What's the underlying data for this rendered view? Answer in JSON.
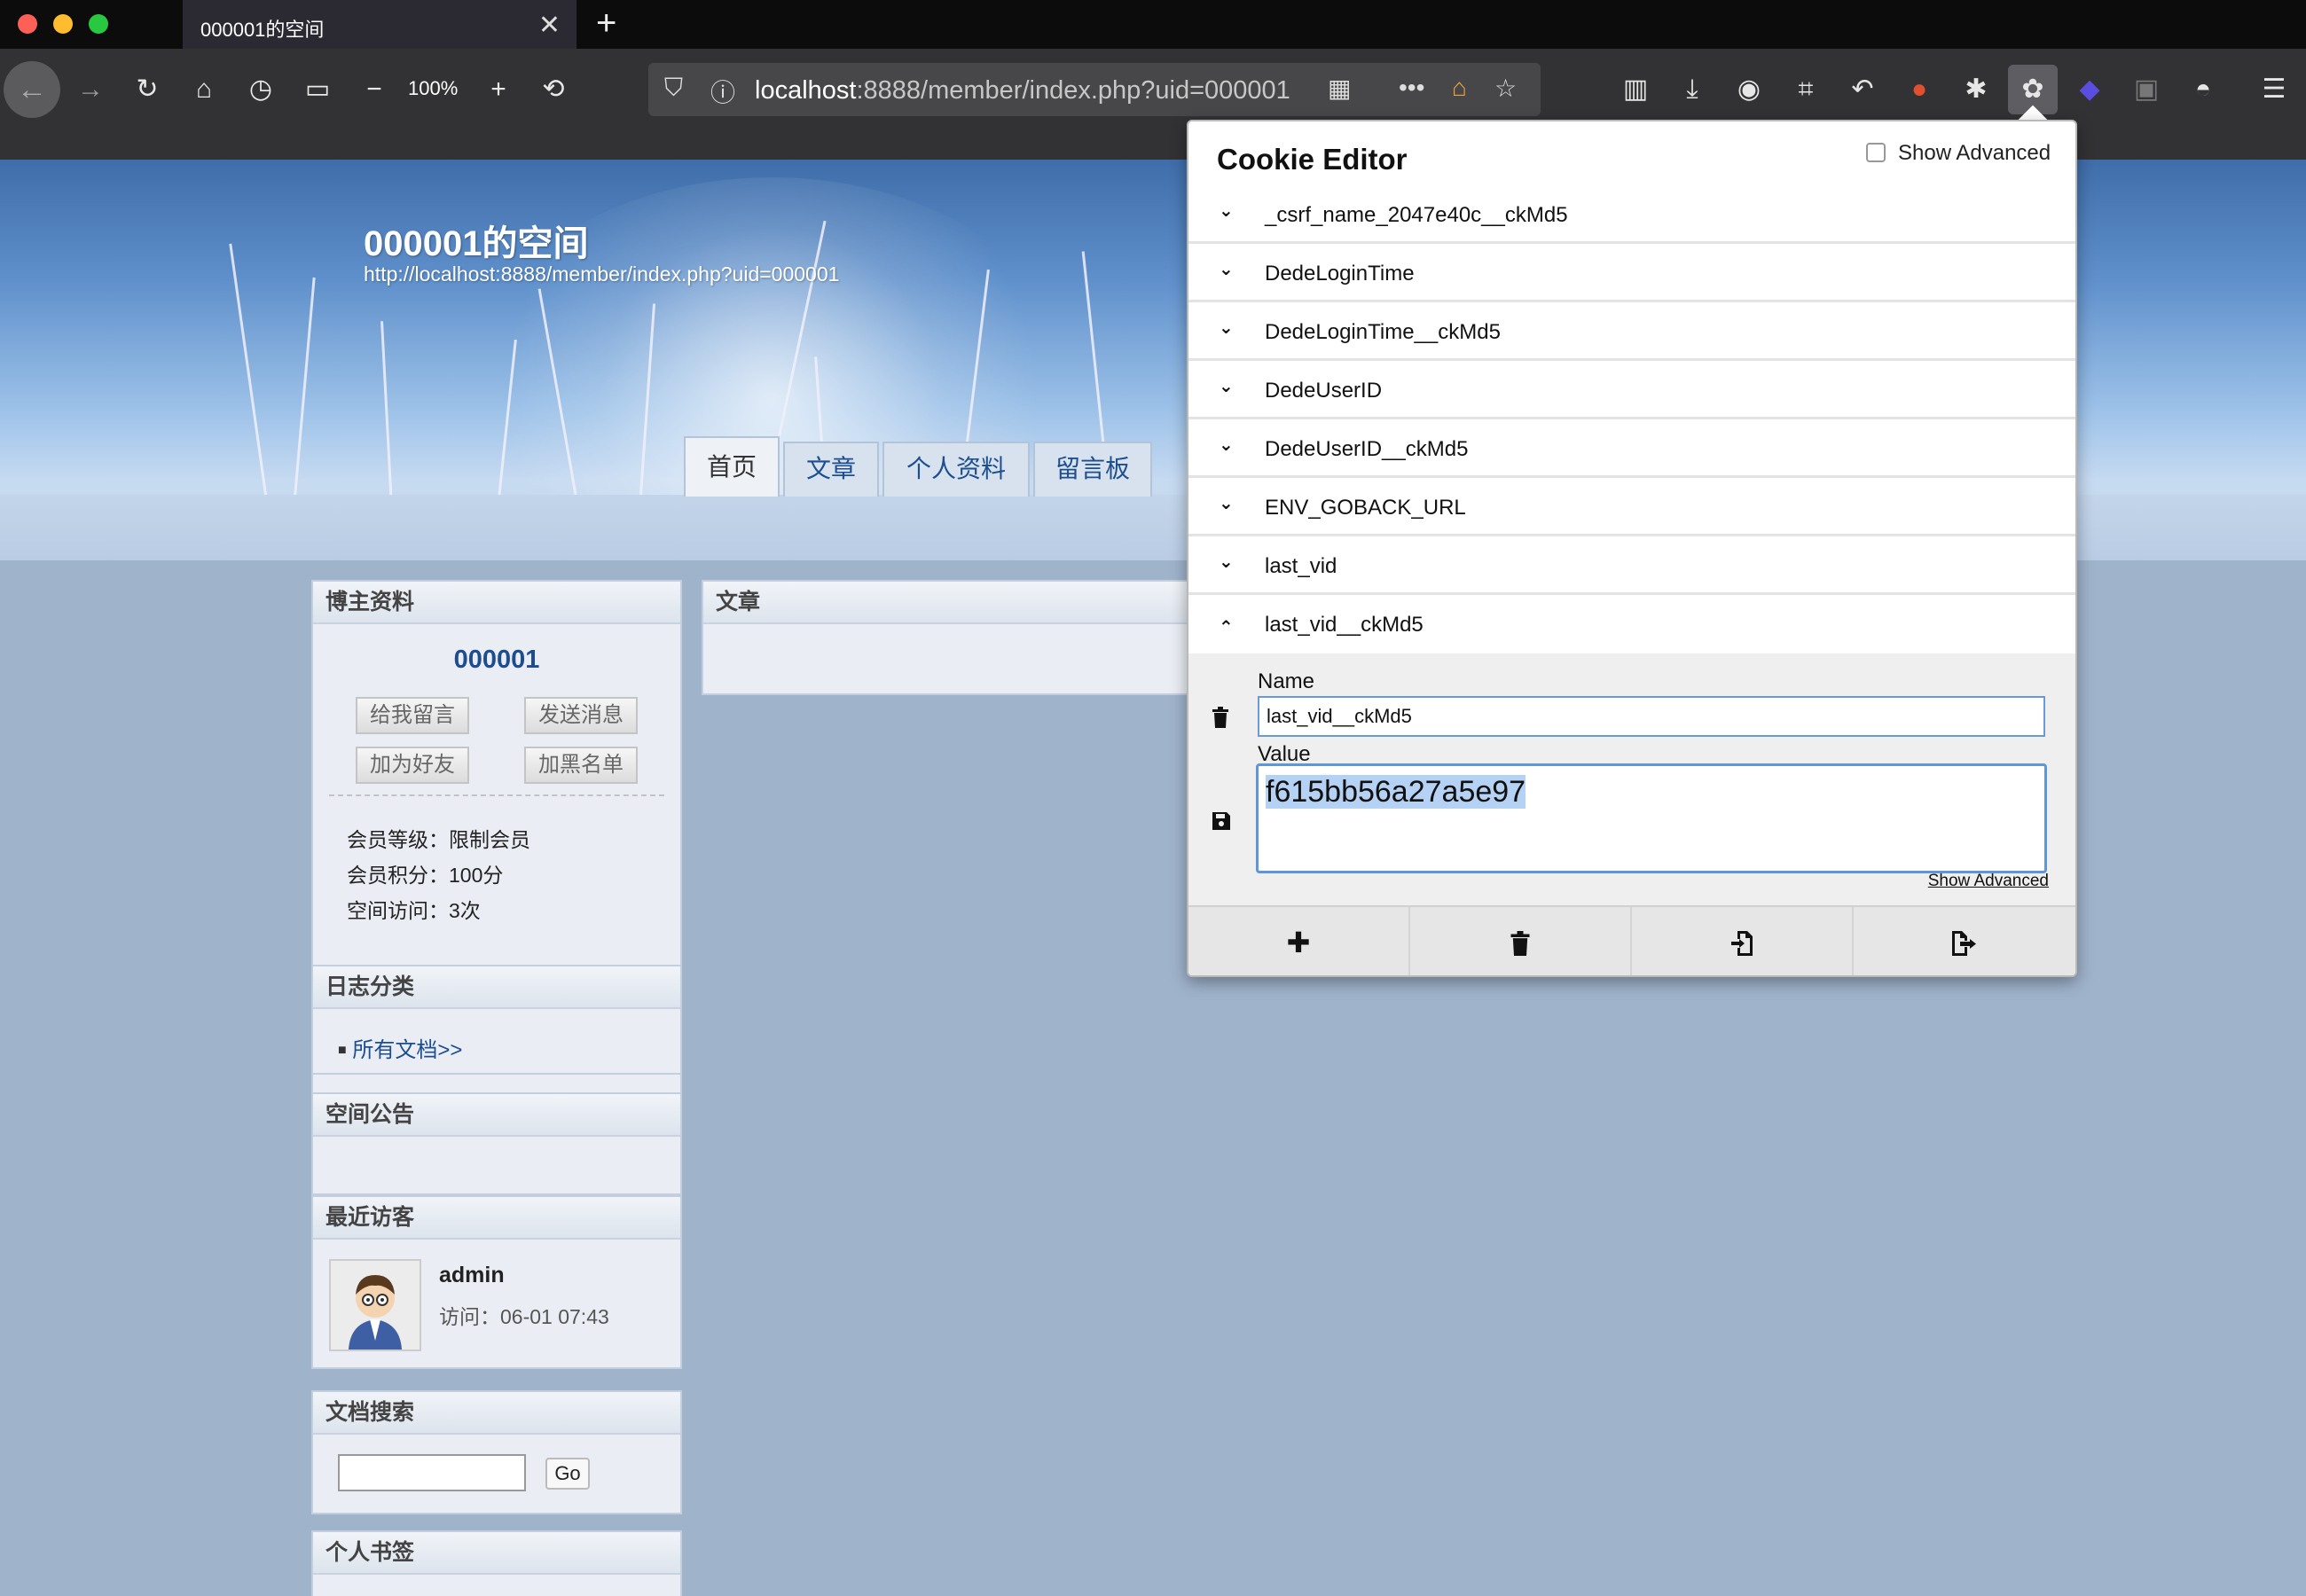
{
  "browser": {
    "tab_title": "000001的空间",
    "tab_close": "✕",
    "new_tab": "+",
    "zoom": "100%",
    "url_host": "localhost",
    "url_rest": ":8888/member/index.php?uid=000001"
  },
  "header": {
    "title": "000001的空间",
    "url": "http://localhost:8888/member/index.php?uid=000001",
    "tabs": [
      "首页",
      "文章",
      "个人资料",
      "留言板"
    ]
  },
  "sidebar": {
    "profile": {
      "heading": "博主资料",
      "username": "000001",
      "buttons": [
        "给我留言",
        "发送消息",
        "加为好友",
        "加黑名单"
      ],
      "level": "会员等级：限制会员",
      "points": "会员积分：100分",
      "visits": "空间访问：3次"
    },
    "categories": {
      "heading": "日志分类",
      "link": "所有文档>>"
    },
    "notice": {
      "heading": "空间公告"
    },
    "visitors": {
      "heading": "最近访客",
      "name": "admin",
      "time": "访问：06-01 07:43"
    },
    "search": {
      "heading": "文档搜索",
      "button": "Go"
    },
    "bookmarks": {
      "heading": "个人书签"
    }
  },
  "main": {
    "heading": "文章"
  },
  "cookie_editor": {
    "title": "Cookie Editor",
    "show_advanced": "Show Advanced",
    "cookies": [
      "_csrf_name_2047e40c__ckMd5",
      "DedeLoginTime",
      "DedeLoginTime__ckMd5",
      "DedeUserID",
      "DedeUserID__ckMd5",
      "ENV_GOBACK_URL",
      "last_vid",
      "last_vid__ckMd5"
    ],
    "name_label": "Name",
    "name_value": "last_vid__ckMd5",
    "value_label": "Value",
    "value_value": "f615bb56a27a5e97",
    "show_advanced_link": "Show Advanced"
  }
}
